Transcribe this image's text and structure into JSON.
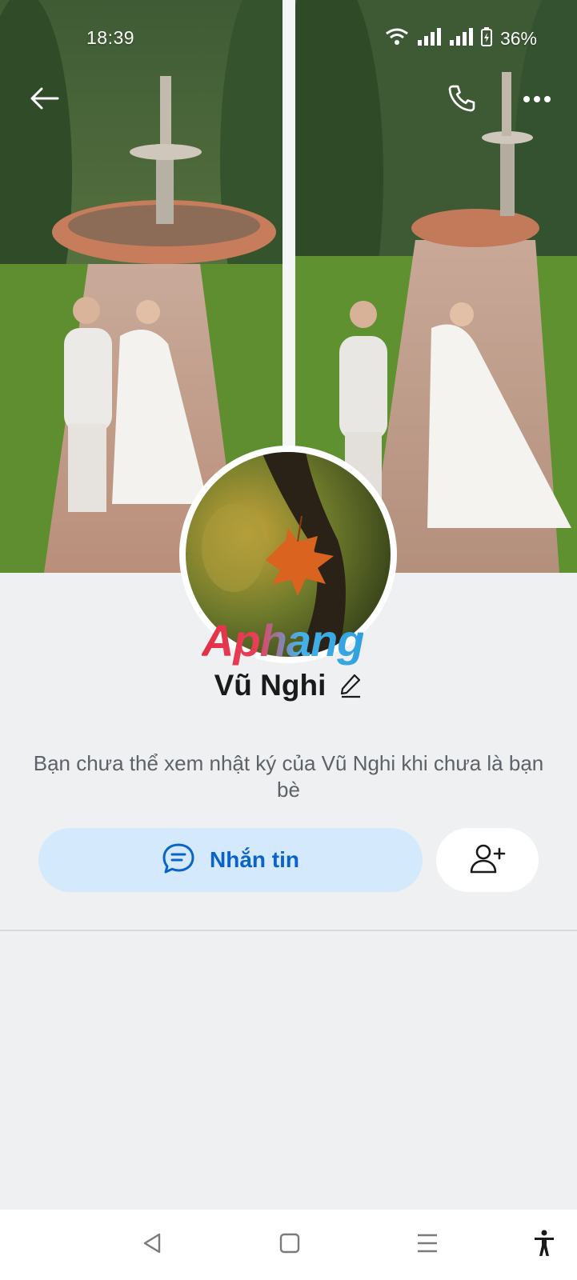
{
  "status_bar": {
    "time": "18:39",
    "battery": "36%"
  },
  "profile": {
    "name": "Vũ Nghi",
    "watermark": "Aphang",
    "diary_note": "Bạn chưa thể xem nhật ký của Vũ Nghi khi chưa là bạn bè"
  },
  "actions": {
    "message_label": "Nhắn tin"
  },
  "icons": {
    "back": "arrow-left-icon",
    "call": "phone-icon",
    "more": "more-dots-icon",
    "edit": "pencil-icon",
    "message": "chat-bubble-icon",
    "add_friend": "add-user-icon"
  },
  "colors": {
    "accent_blue": "#0a63c9",
    "message_button_bg": "#d5e9fc",
    "page_bg": "#eef0f1"
  }
}
